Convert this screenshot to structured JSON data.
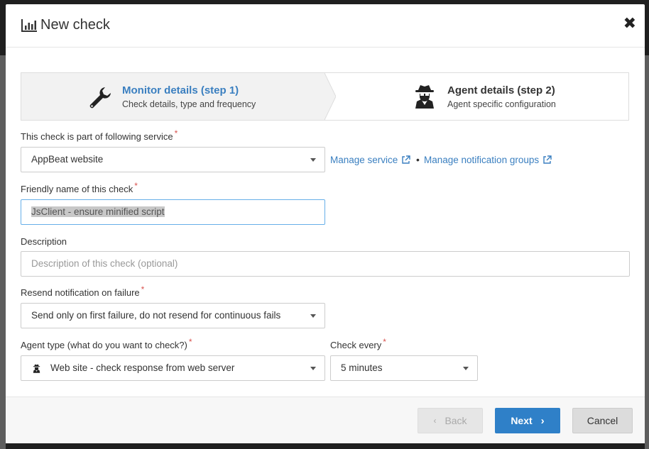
{
  "modal": {
    "title": "New check",
    "icons": {
      "title": "bar-chart-icon",
      "close": "close-icon"
    }
  },
  "steps": [
    {
      "title": "Monitor details (step 1)",
      "subtitle": "Check details, type and frequency",
      "active": true,
      "icon": "wrench-icon",
      "color": "#3a7fc0"
    },
    {
      "title": "Agent details (step 2)",
      "subtitle": "Agent specific configuration",
      "active": false,
      "icon": "spy-agent-icon",
      "color": "#333333"
    }
  ],
  "form": {
    "service": {
      "label": "This check is part of following service",
      "value": "AppBeat website"
    },
    "links": {
      "manage_service": "Manage service",
      "separator": "•",
      "manage_groups": "Manage notification groups"
    },
    "friendly_name": {
      "label": "Friendly name of this check",
      "value": "JsClient - ensure minified script"
    },
    "description": {
      "label": "Description",
      "placeholder": "Description of this check (optional)"
    },
    "resend": {
      "label": "Resend notification on failure",
      "value": "Send only on first failure, do not resend for continuous fails"
    },
    "agent_type": {
      "label": "Agent type (what do you want to check?)",
      "value": "Web site - check response from web server",
      "icon": "spy-agent-icon"
    },
    "check_every": {
      "label": "Check every",
      "value": "5 minutes"
    },
    "required_mark": "*"
  },
  "footer": {
    "back": "Back",
    "next": "Next",
    "cancel": "Cancel",
    "back_enabled": false
  },
  "colors": {
    "accent": "#2f80c8",
    "link": "#3a7fc0",
    "required": "#d9534f"
  }
}
